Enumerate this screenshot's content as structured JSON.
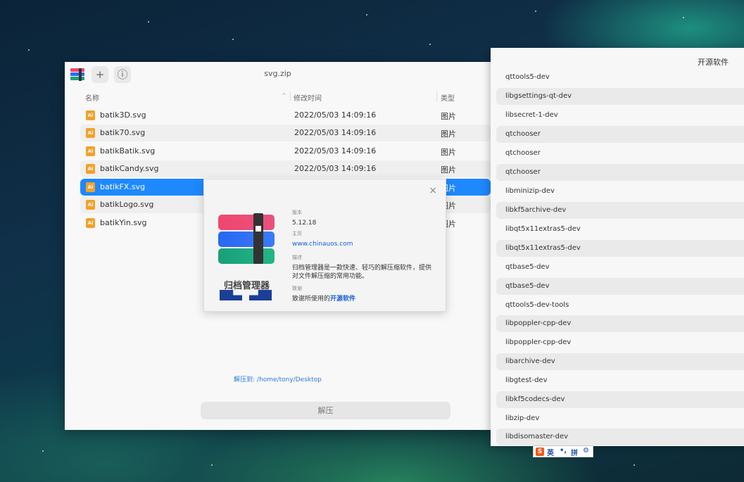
{
  "window": {
    "title": "svg.zip",
    "add_icon": "plus-icon",
    "info_icon": "info-icon",
    "add_glyph": "+",
    "info_glyph": "ⓘ"
  },
  "table": {
    "headers": [
      "名称",
      "修改时间",
      "类型"
    ],
    "sort_glyph": "^",
    "rows": [
      {
        "name": "batik3D.svg",
        "date": "2022/05/03 14:09:16",
        "type": "图片"
      },
      {
        "name": "batik70.svg",
        "date": "2022/05/03 14:09:16",
        "type": "图片"
      },
      {
        "name": "batikBatik.svg",
        "date": "2022/05/03 14:09:16",
        "type": "图片"
      },
      {
        "name": "batikCandy.svg",
        "date": "2022/05/03 14:09:16",
        "type": "图片"
      },
      {
        "name": "batikFX.svg",
        "date": "",
        "type": "图片"
      },
      {
        "name": "batikLogo.svg",
        "date": "",
        "type": "图片"
      },
      {
        "name": "batikYin.svg",
        "date": "",
        "type": "图片"
      }
    ],
    "file_icon_glyph": "Ai"
  },
  "footer": {
    "extract_path": "解压到: /home/tony/Desktop",
    "extract_button": "解压"
  },
  "about": {
    "close_glyph": "×",
    "app_name": "归档管理器",
    "version_label": "版本",
    "version": "5.12.18",
    "homepage_label": "主页",
    "homepage": "www.chinauos.com",
    "desc_label": "描述",
    "description": "归档管理器是一款快速、轻巧的解压缩软件，提供对文件解压缩的常用功能。",
    "ack_label": "致谢",
    "ack_text": "致谢所使用的",
    "ack_link": "开源软件"
  },
  "open_source_panel": {
    "title": "开源软件",
    "items": [
      "qttools5-dev",
      "libgsettings-qt-dev",
      "libsecret-1-dev",
      "qtchooser",
      "qtchooser",
      "qtchooser",
      "libminizip-dev",
      "libkf5archive-dev",
      "libqt5x11extras5-dev",
      "libqt5x11extras5-dev",
      "qtbase5-dev",
      "qtbase5-dev",
      "qttools5-dev-tools",
      "libpoppler-cpp-dev",
      "libpoppler-cpp-dev",
      "libarchive-dev",
      "libgtest-dev",
      "libkf5codecs-dev",
      "libzip-dev",
      "libdisomaster-dev"
    ]
  },
  "ime": {
    "logo": "S",
    "lang": "英",
    "punct": "•,",
    "mode": "拼",
    "settings_glyph": "⚙"
  },
  "colors": {
    "accent": "#1e88ff",
    "link": "#1a5fd6"
  }
}
